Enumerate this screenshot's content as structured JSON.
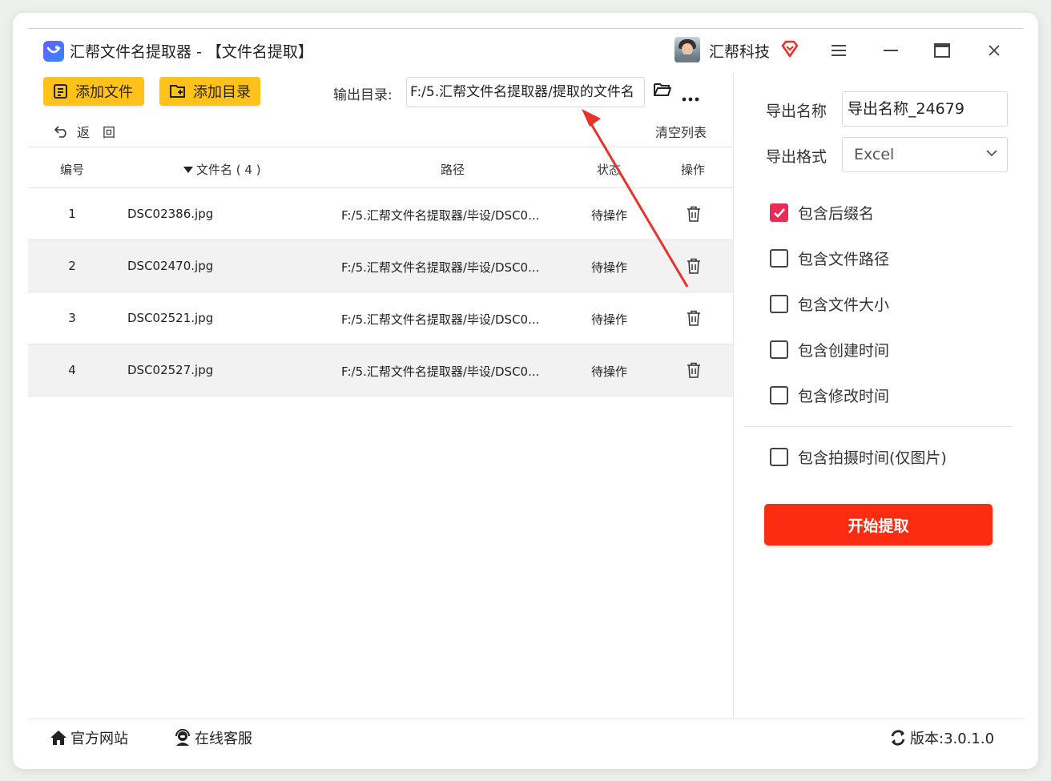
{
  "window": {
    "title": "汇帮文件名提取器 - 【文件名提取】",
    "company": "汇帮科技"
  },
  "toolbar": {
    "add_file": "添加文件",
    "add_dir": "添加目录",
    "output_label": "输出目录:",
    "output_value": "F:/5.汇帮文件名提取器/提取的文件名",
    "back": "返回",
    "clear": "清空列表"
  },
  "table": {
    "headers": {
      "num": "编号",
      "name": "文件名 ( 4 )",
      "path": "路径",
      "status": "状态",
      "op": "操作"
    },
    "rows": [
      {
        "num": "1",
        "name": "DSC02386.jpg",
        "path": "F:/5.汇帮文件名提取器/毕设/DSC0...",
        "status": "待操作"
      },
      {
        "num": "2",
        "name": "DSC02470.jpg",
        "path": "F:/5.汇帮文件名提取器/毕设/DSC0...",
        "status": "待操作"
      },
      {
        "num": "3",
        "name": "DSC02521.jpg",
        "path": "F:/5.汇帮文件名提取器/毕设/DSC0...",
        "status": "待操作"
      },
      {
        "num": "4",
        "name": "DSC02527.jpg",
        "path": "F:/5.汇帮文件名提取器/毕设/DSC0...",
        "status": "待操作"
      }
    ]
  },
  "panel": {
    "export_name_label": "导出名称",
    "export_name_value": "导出名称_24679",
    "export_format_label": "导出格式",
    "export_format_value": "Excel",
    "options": [
      {
        "label": "包含后缀名",
        "checked": true
      },
      {
        "label": "包含文件路径",
        "checked": false
      },
      {
        "label": "包含文件大小",
        "checked": false
      },
      {
        "label": "包含创建时间",
        "checked": false
      },
      {
        "label": "包含修改时间",
        "checked": false
      },
      {
        "label": "包含拍摄时间(仅图片)",
        "checked": false
      }
    ],
    "start": "开始提取"
  },
  "footer": {
    "site": "官方网站",
    "service": "在线客服",
    "version": "版本:3.0.1.0"
  },
  "colors": {
    "accent_yellow": "#ffc21a",
    "start_red": "#fb2c12",
    "checkbox_on": "#ec2a55",
    "arrow_red": "#e8332a"
  }
}
